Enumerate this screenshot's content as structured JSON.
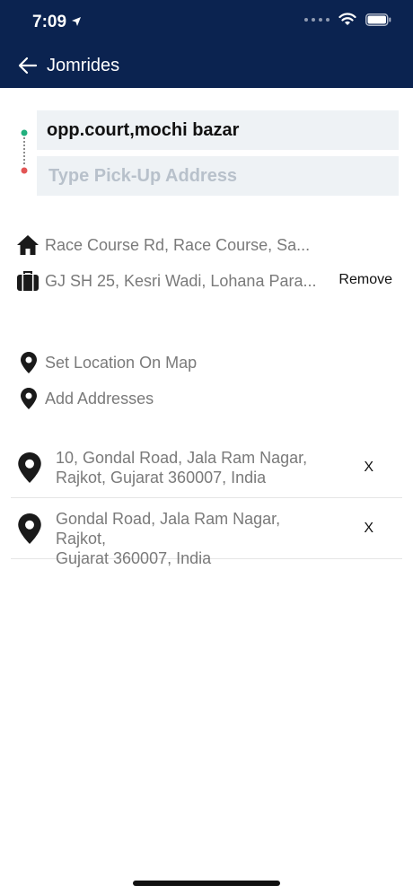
{
  "status_bar": {
    "time": "7:09"
  },
  "nav": {
    "title": "Jomrides"
  },
  "drop_field": {
    "value": "opp.court,mochi bazar"
  },
  "pickup_field": {
    "placeholder": "Type Pick-Up Address"
  },
  "favorites": [
    {
      "icon": "home-icon",
      "label": "Race Course Rd, Race Course, Sa..."
    },
    {
      "icon": "briefcase-icon",
      "label": "GJ SH 25, Kesri Wadi, Lohana Para..."
    }
  ],
  "remove_label": "Remove",
  "options": [
    {
      "label": "Set Location On Map"
    },
    {
      "label": "Add Addresses"
    }
  ],
  "recent": [
    {
      "line1": "10, Gondal Road, Jala Ram Nagar,",
      "line2": "Rajkot, Gujarat 360007, India",
      "close": "X"
    },
    {
      "line1": "Gondal Road, Jala Ram Nagar, Rajkot,",
      "line2": "Gujarat 360007, India",
      "close": "X"
    }
  ]
}
